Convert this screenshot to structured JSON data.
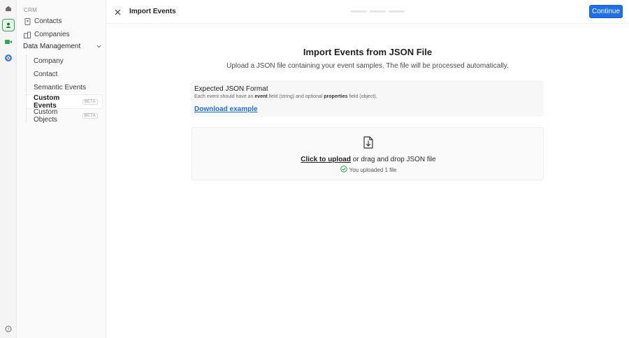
{
  "rail": {
    "icons": [
      "home-icon",
      "crm-icon",
      "video-icon",
      "hub-icon",
      "help-icon"
    ],
    "active_color": "#2fa84f"
  },
  "sidebar": {
    "section_label": "CRM",
    "items": [
      {
        "label": "Contacts",
        "icon": "contact-card-icon"
      },
      {
        "label": "Companies",
        "icon": "building-icon"
      }
    ],
    "group": {
      "label": "Data Management",
      "expanded": true,
      "children": [
        {
          "label": "Company",
          "badge": "",
          "active": false
        },
        {
          "label": "Contact",
          "badge": "",
          "active": false
        },
        {
          "label": "Semantic Events",
          "badge": "",
          "active": false
        },
        {
          "label": "Custom Events",
          "badge": "BETA",
          "active": true
        },
        {
          "label": "Custom Objects",
          "badge": "BETA",
          "active": false
        }
      ]
    }
  },
  "header": {
    "title": "Import Events",
    "continue_label": "Continue",
    "accent": "#1f6fe5"
  },
  "main": {
    "heading": "Import Events from JSON File",
    "subheading": "Upload a JSON file containing your event samples. The file will be processed automatically.",
    "format": {
      "title": "Expected JSON Format",
      "desc_prefix": "Each event should have an",
      "desc_event": "event",
      "desc_mid": "field (string) and optional",
      "desc_properties": "properties",
      "desc_suffix": "field (object).",
      "download_label": "Download example"
    },
    "upload": {
      "click_label": "Click to upload",
      "rest_label": "or drag and drop JSON file",
      "status": "You uploaded 1 file",
      "status_color": "#2fa84f"
    }
  }
}
